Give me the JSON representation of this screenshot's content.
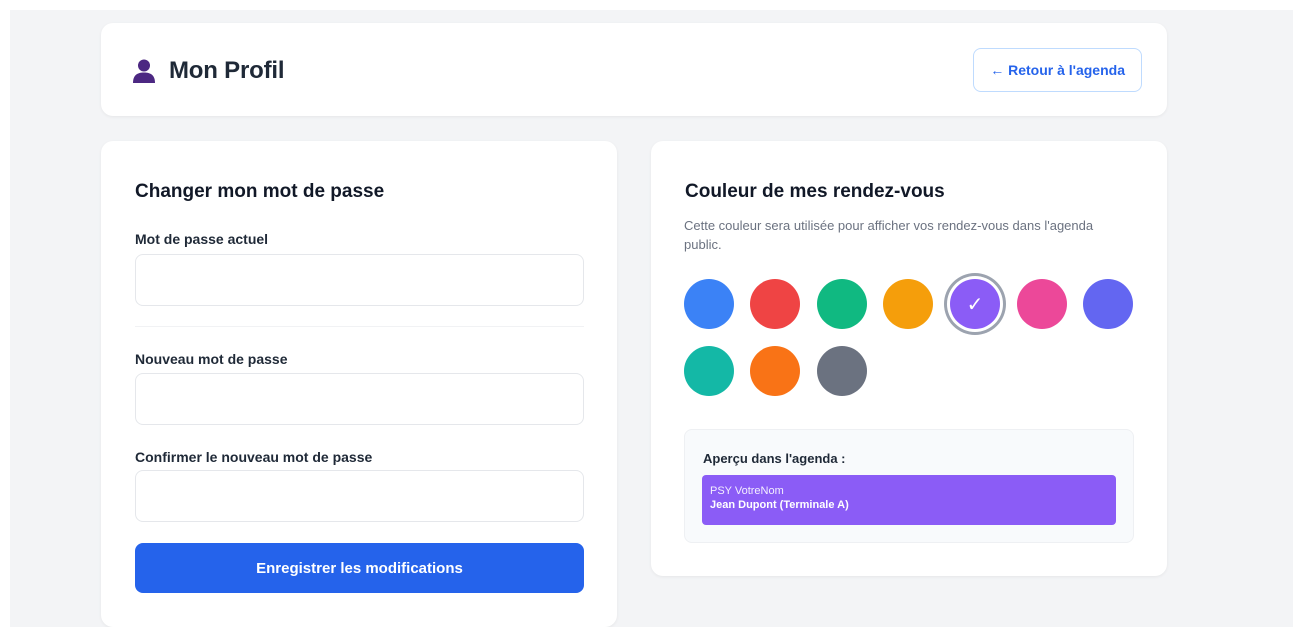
{
  "header": {
    "title": "Mon Profil",
    "back_label": "← Retour à l'agenda",
    "user_icon": "user-icon",
    "user_icon_color": "#4c2882"
  },
  "password": {
    "title": "Changer mon mot de passe",
    "current_label": "Mot de passe actuel",
    "current_value": "",
    "new_label": "Nouveau mot de passe",
    "new_value": "",
    "confirm_label": "Confirmer le nouveau mot de passe",
    "confirm_value": "",
    "save_label": "Enregistrer les modifications"
  },
  "colors": {
    "title": "Couleur de mes rendez-vous",
    "description": "Cette couleur sera utilisée pour afficher vos rendez-vous dans l'agenda public.",
    "selected_mark": "✓",
    "selected_index": 4,
    "swatches": [
      "#3b82f6",
      "#ef4444",
      "#10b981",
      "#f59e0b",
      "#8b5cf6",
      "#ec4899",
      "#6366f1",
      "#14b8a6",
      "#f97316",
      "#6b7280"
    ],
    "preview": {
      "label": "Aperçu dans l'agenda :",
      "line1": "PSY VotreNom",
      "line2": "Jean Dupont (Terminale A)",
      "color": "#8b5cf6"
    }
  },
  "theme": {
    "primary": "#2563eb",
    "background": "#f3f4f6"
  }
}
